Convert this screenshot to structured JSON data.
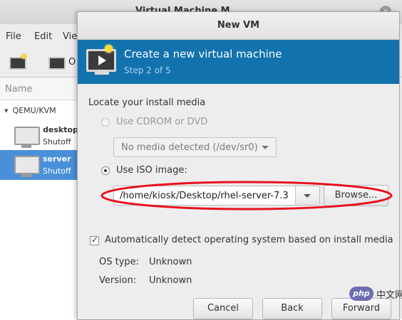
{
  "background_window": {
    "title": "Virtual Machine M",
    "close_glyph": "×",
    "menu": [
      "File",
      "Edit",
      "Vie"
    ],
    "toolbar_partial_label": "O",
    "list_header": "Name",
    "connection_label": "QEMU/KVM",
    "connection_arrow": "▾",
    "vms": [
      {
        "name": "desktop",
        "status": "Shutoff",
        "selected": false
      },
      {
        "name": "server",
        "status": "Shutoff",
        "selected": true
      }
    ]
  },
  "dialog": {
    "title": "New VM",
    "header": {
      "title": "Create a new virtual machine",
      "step": "Step 2 of 5",
      "icon": "new-vm-monitor-icon"
    },
    "section_label": "Locate your install media",
    "cdrom_option": {
      "label": "Use CDROM or DVD",
      "selected": false,
      "enabled": false
    },
    "cdrom_combo": {
      "value": "No media detected (/dev/sr0)",
      "enabled": false
    },
    "iso_option": {
      "label": "Use ISO image:",
      "selected": true
    },
    "iso_path": {
      "value": "/home/kiosk/Desktop/rhel-server-7.3"
    },
    "browse_label": "Browse...",
    "autodetect": {
      "label": "Automatically detect operating system based on install media",
      "checked": true
    },
    "os_type": {
      "label": "OS type:",
      "value": "Unknown"
    },
    "version": {
      "label": "Version:",
      "value": "Unknown"
    },
    "buttons": {
      "cancel": "Cancel",
      "back": "Back",
      "forward": "Forward"
    }
  },
  "annotation": {
    "color": "#e8101e",
    "shape": "ellipse",
    "target": "iso-path-and-browse"
  },
  "watermark": {
    "logo_text": "php",
    "text": "中文网"
  },
  "colors": {
    "header_bg": "#1272ad",
    "selection_bg": "#4a90d9"
  }
}
